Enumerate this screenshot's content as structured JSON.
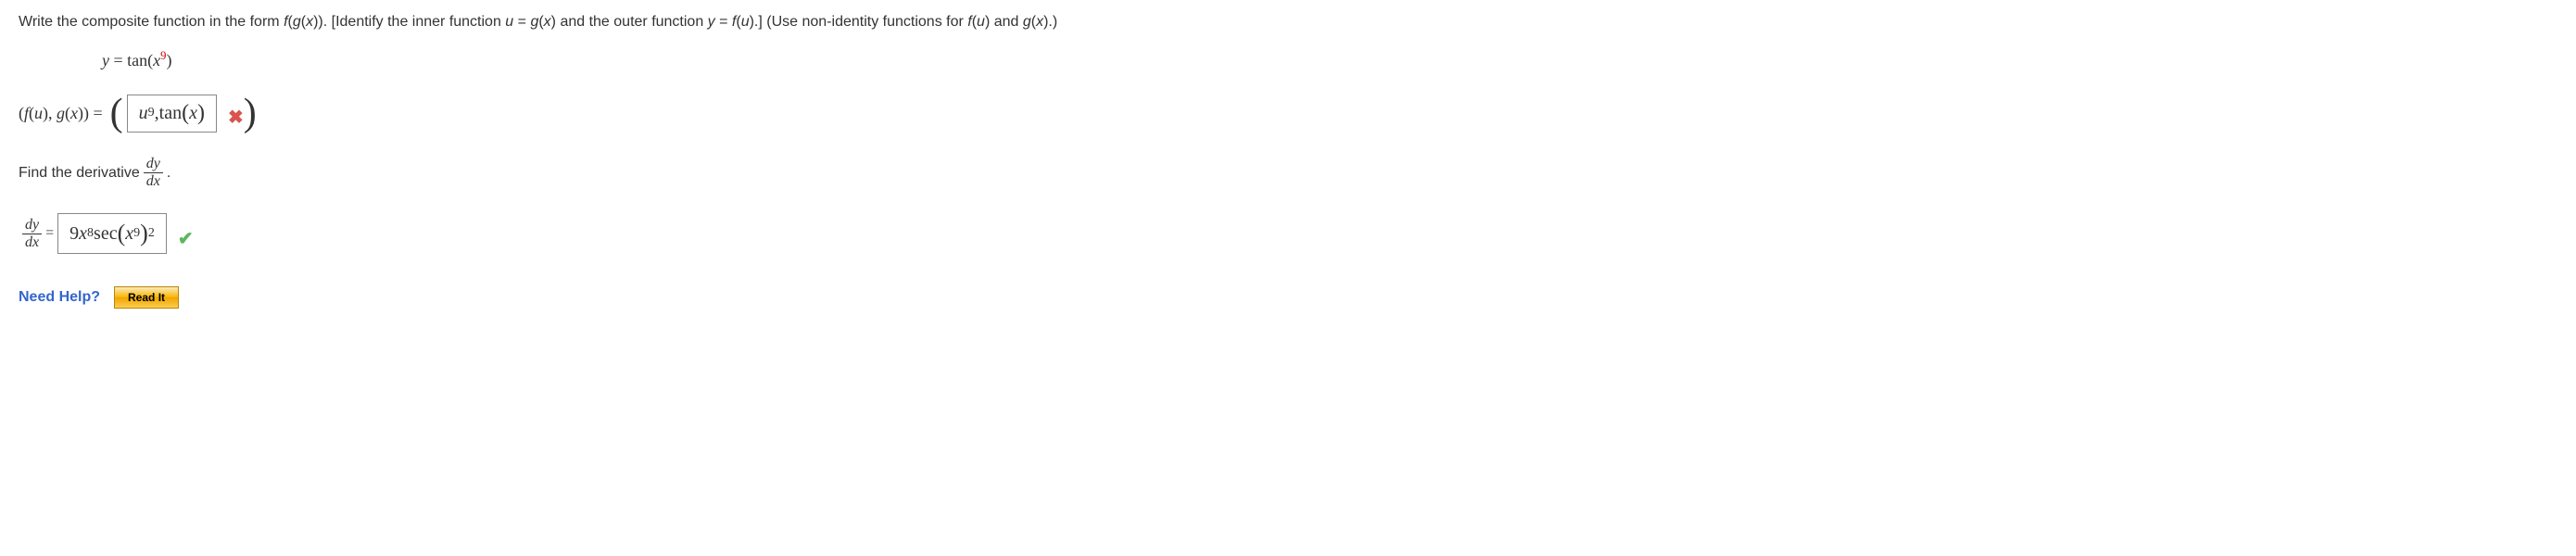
{
  "prompt": {
    "text_parts": [
      "Write the composite function in the form ",
      "f",
      "(",
      "g",
      "(",
      "x",
      ")). [Identify the inner function ",
      "u",
      " = ",
      "g",
      "(",
      "x",
      ") and the outer function ",
      "y",
      " = ",
      "f",
      "(",
      "u",
      ").] (Use non-identity functions for ",
      "f",
      "(",
      "u",
      ") and ",
      "g",
      "(",
      "x",
      ").)"
    ]
  },
  "equation": {
    "lhs": "y",
    "equals": " = ",
    "func": "tan(",
    "var": "x",
    "exp": "9",
    "close": ")"
  },
  "answer1": {
    "label_f": "f",
    "label_u": "u",
    "label_g": "g",
    "label_x": "x",
    "label_open": "(",
    "label_close": ")",
    "label_comma": ", ",
    "equals": " = ",
    "paren_open": "(",
    "paren_close": ")",
    "value": "u⁹, tan(x)",
    "u_var": "u",
    "u_exp": "9",
    "comma": ", ",
    "tan_part": "tan",
    "tan_open": "(",
    "tan_x": "x",
    "tan_close": ")",
    "feedback": "incorrect"
  },
  "derivative_prompt": {
    "text": "Find the derivative ",
    "dy": "dy",
    "dx": "dx",
    "period": "."
  },
  "answer2": {
    "dy": "dy",
    "dx": "dx",
    "equals": " = ",
    "coef": "9",
    "x_var": "x",
    "x_exp": "8",
    "sec": "sec",
    "inner_open": "(",
    "inner_x": "x",
    "inner_exp": "9",
    "inner_close": ")",
    "outer_exp": "2",
    "feedback": "correct"
  },
  "help": {
    "label": "Need Help?",
    "read_it": "Read It"
  }
}
